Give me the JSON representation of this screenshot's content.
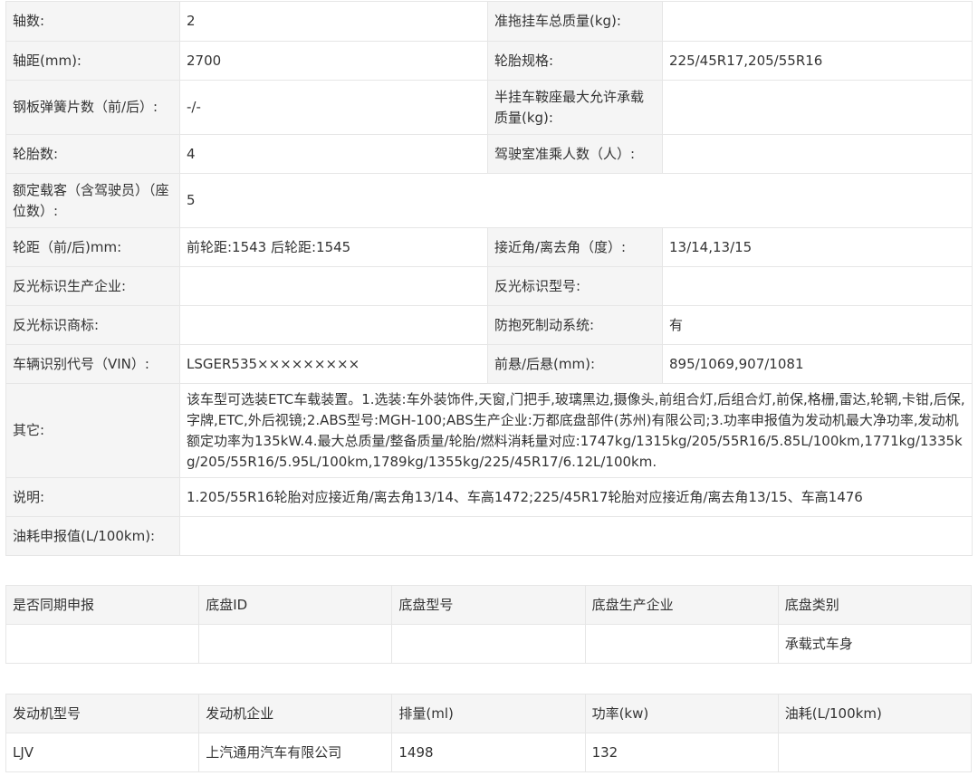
{
  "params": {
    "axle_count_label": "轴数:",
    "axle_count_value": "2",
    "trailer_mass_label": "准拖挂车总质量(kg):",
    "trailer_mass_value": "",
    "wheelbase_label": "轴距(mm):",
    "wheelbase_value": "2700",
    "tire_spec_label": "轮胎规格:",
    "tire_spec_value": "225/45R17,205/55R16",
    "leaf_spring_label": "钢板弹簧片数（前/后）:",
    "leaf_spring_value": "-/-",
    "saddle_load_label": "半挂车鞍座最大允许承载质量(kg):",
    "saddle_load_value": "",
    "tire_count_label": "轮胎数:",
    "tire_count_value": "4",
    "cab_passengers_label": "驾驶室准乘人数（人）:",
    "cab_passengers_value": "",
    "rated_passengers_label": "额定载客（含驾驶员）（座位数）:",
    "rated_passengers_value": "5",
    "track_label": "轮距（前/后)mm:",
    "track_value": "前轮距:1543 后轮距:1545",
    "approach_label": "接近角/离去角（度）:",
    "approach_value": "13/14,13/15",
    "reflector_maker_label": "反光标识生产企业:",
    "reflector_maker_value": "",
    "reflector_model_label": "反光标识型号:",
    "reflector_model_value": "",
    "reflector_brand_label": "反光标识商标:",
    "reflector_brand_value": "",
    "abs_label": "防抱死制动系统:",
    "abs_value": "有",
    "vin_label": "车辆识别代号（VIN）:",
    "vin_value": "LSGER535×××××××××",
    "overhang_label": "前悬/后悬(mm):",
    "overhang_value": "895/1069,907/1081",
    "other_label": "其它:",
    "other_value": "该车型可选装ETC车载装置。1.选装:车外装饰件,天窗,门把手,玻璃黑边,摄像头,前组合灯,后组合灯,前保,格栅,雷达,轮辋,卡钳,后保,字牌,ETC,外后视镜;2.ABS型号:MGH-100;ABS生产企业:万都底盘部件(苏州)有限公司;3.功率申报值为发动机最大净功率,发动机额定功率为135kW.4.最大总质量/整备质量/轮胎/燃料消耗量对应:1747kg/1315kg/205/55R16/5.85L/100km,1771kg/1335kg/205/55R16/5.95L/100km,1789kg/1355kg/225/45R17/6.12L/100km.",
    "note_label": "说明:",
    "note_value": "1.205/55R16轮胎对应接近角/离去角13/14、车高1472;225/45R17轮胎对应接近角/离去角13/15、车高1476",
    "fuel_decl_label": "油耗申报值(L/100km):",
    "fuel_decl_value": ""
  },
  "chassis": {
    "headers": [
      "是否同期申报",
      "底盘ID",
      "底盘型号",
      "底盘生产企业",
      "底盘类别"
    ],
    "row": [
      "",
      "",
      "",
      "",
      "承载式车身"
    ]
  },
  "engine": {
    "headers": [
      "发动机型号",
      "发动机企业",
      "排量(ml)",
      "功率(kw)",
      "油耗(L/100km)"
    ],
    "row": [
      "LJV",
      "上汽通用汽车有限公司",
      "1498",
      "132",
      ""
    ]
  }
}
